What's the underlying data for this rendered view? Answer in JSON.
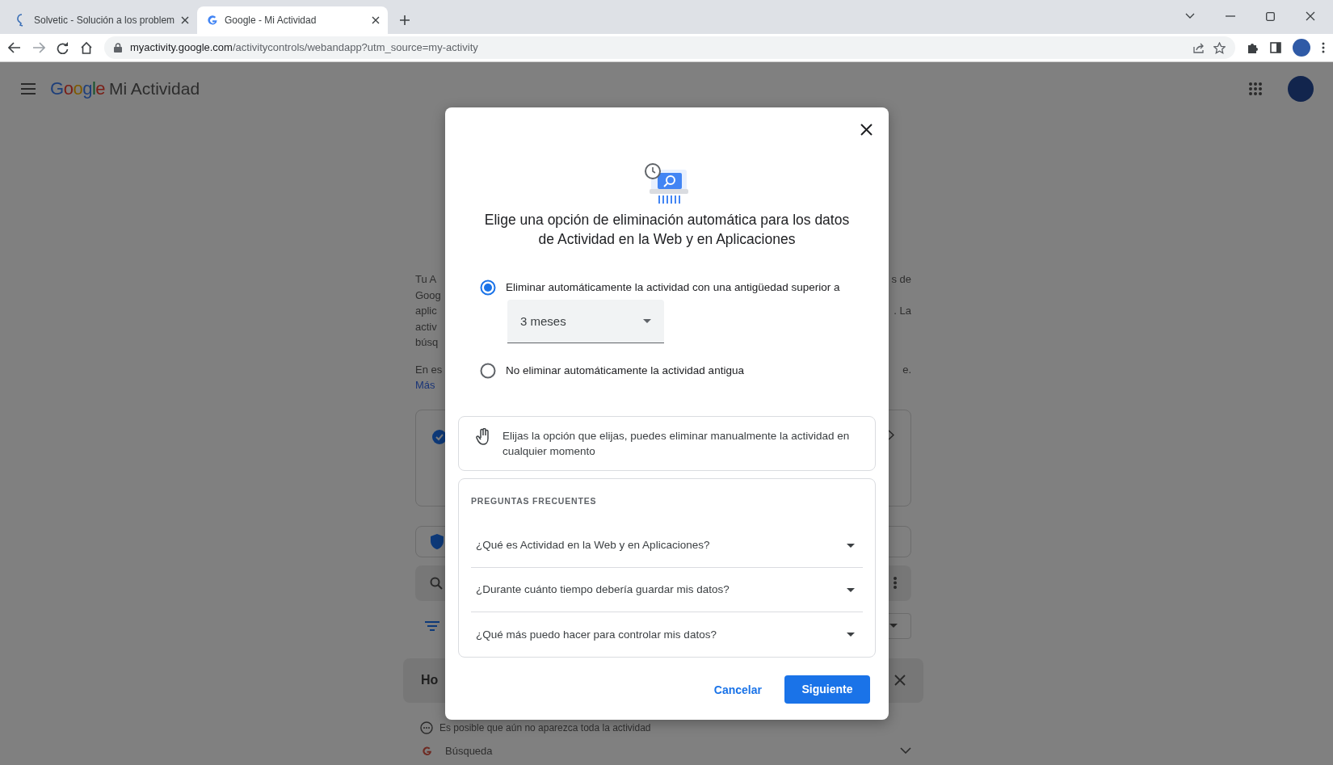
{
  "browser": {
    "tabs": [
      {
        "title": "Solvetic - Solución a los problem",
        "selected": false
      },
      {
        "title": "Google - Mi Actividad",
        "selected": true
      }
    ],
    "url": {
      "host": "myactivity.google.com",
      "path": "/activitycontrols/webandapp?utm_source=my-activity"
    }
  },
  "app_header": {
    "logo": "Google",
    "title": "Mi Actividad"
  },
  "background": {
    "paragraph_lines": [
      {
        "left": "Tu A",
        "right": "s de"
      },
      {
        "left": "Goog"
      },
      {
        "left": "aplic",
        "right": ". La"
      },
      {
        "left": "activ"
      },
      {
        "left": "búsq"
      }
    ],
    "second_paragraph": {
      "left": "En es",
      "right": "e.",
      "link": "Más"
    },
    "history_title": "Ho",
    "notice": "Es posible que aún no aparezca toda la actividad",
    "first_group": "Búsqueda"
  },
  "dialog": {
    "heading": "Elige una opción de eliminación automática para los datos de Actividad en la Web y en Aplicaciones",
    "options": [
      {
        "label": "Eliminar automáticamente la actividad con una antigüedad superior a",
        "selected": true
      },
      {
        "label": "No eliminar automáticamente la actividad antigua",
        "selected": false
      }
    ],
    "period": {
      "value": "3 meses"
    },
    "info": "Elijas la opción que elijas, puedes eliminar manualmente la actividad en cualquier momento",
    "faq": {
      "title": "PREGUNTAS FRECUENTES",
      "items": [
        {
          "question": "¿Qué es Actividad en la Web y en Aplicaciones?",
          "expanded": false
        },
        {
          "question": "¿Durante cuánto tiempo debería guardar mis datos?",
          "expanded": false
        },
        {
          "question": "¿Qué más puedo hacer para controlar mis datos?",
          "expanded": false
        }
      ]
    },
    "buttons": [
      {
        "label": "Cancelar",
        "kind": "text"
      },
      {
        "label": "Siguiente",
        "kind": "primary"
      }
    ]
  }
}
